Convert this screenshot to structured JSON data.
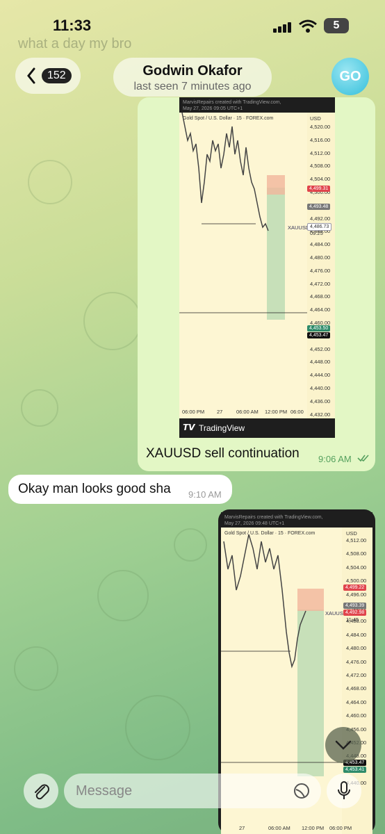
{
  "status": {
    "time": "11:33",
    "battery": "5"
  },
  "ghost_text": "what a day my bro",
  "header": {
    "back_count": "152",
    "name": "Godwin Okafor",
    "last_seen": "last seen 7 minutes ago",
    "avatar_initials": "GO"
  },
  "messages": {
    "chart1": {
      "watermark": "MarvisRepairs created with TradingView.com,",
      "date": "May 27, 2026 09:05 UTC+1",
      "symbol": "Gold Spot / U.S. Dollar · 15 · FOREX.com",
      "currency": "USD",
      "prices": [
        "4,520.00",
        "4,516.00",
        "4,512.00",
        "4,508.00",
        "4,504.00",
        "4,500.00",
        "4,496.00",
        "4,492.00",
        "4,488.00",
        "4,484.00",
        "4,480.00",
        "4,476.00",
        "4,472.00",
        "4,468.00",
        "4,464.00",
        "4,460.00",
        "4,456.00",
        "4,452.00",
        "4,448.00",
        "4,444.00",
        "4,440.00",
        "4,436.00",
        "4,432.00"
      ],
      "tag_sl": "4,499.31",
      "tag_entry": "4,493.48",
      "tag_sym": "XAUUSD",
      "tag_current": "4,486.73",
      "tag_timer": "09:25",
      "tag_tp": "4,453.50",
      "tag_low": "4,453.47",
      "times": [
        "06:00 PM",
        "27",
        "06:00 AM",
        "12:00 PM",
        "06:00"
      ],
      "brand": "TradingView"
    },
    "caption1": "XAUUSD sell continuation",
    "time1": "9:06 AM",
    "reply": "Okay man looks good sha",
    "reply_time": "9:10 AM",
    "chart2": {
      "watermark": "MarvisRepairs created with TradingView.com,",
      "date": "May 27, 2026 09:48 UTC+1",
      "symbol": "Gold Spot / U.S. Dollar · 15 · FOREX.com",
      "currency": "USD",
      "prices": [
        "4,512.00",
        "4,508.00",
        "4,504.00",
        "4,500.00",
        "4,496.00",
        "4,492.00",
        "4,488.00",
        "4,484.00",
        "4,480.00",
        "4,476.00",
        "4,472.00",
        "4,468.00",
        "4,464.00",
        "4,460.00",
        "4,456.00",
        "4,452.00",
        "4,448.00",
        "4,444.00",
        "4,440.00"
      ],
      "tag_sl": "4,499.22",
      "tag_entry": "4,493.39",
      "tag_sym": "XAUUSD",
      "tag_current": "4,492.98",
      "tag_timer": "11:45",
      "tag_tp": "4,453.47",
      "tag_low": "4,453.41",
      "times": [
        "27",
        "06:00 AM",
        "12:00 PM",
        "06:00 PM"
      ]
    }
  },
  "composer": {
    "placeholder": "Message"
  },
  "colors": {
    "outgoing": "#e3f7c5",
    "check": "#55a05e",
    "avatar": "#34bfdb"
  }
}
